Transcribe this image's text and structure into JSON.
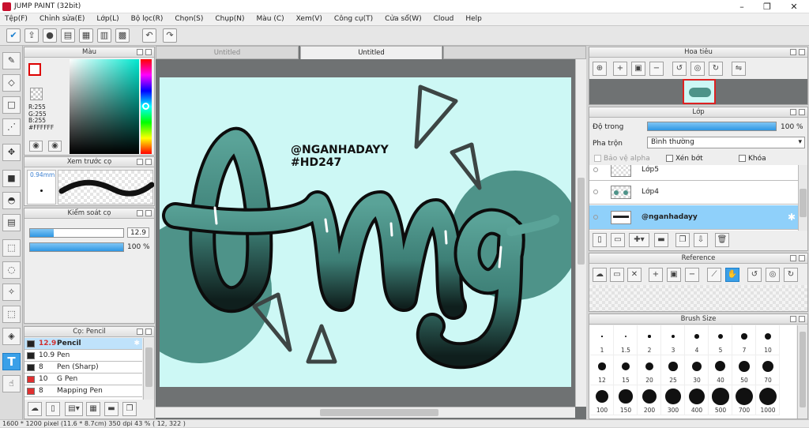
{
  "app": {
    "title": "JUMP PAINT (32bit)"
  },
  "menu": [
    "Tệp(F)",
    "Chỉnh sửa(E)",
    "Lớp(L)",
    "Bộ lọc(R)",
    "Chọn(S)",
    "Chụp(N)",
    "Màu (C)",
    "Xem(V)",
    "Công cụ(T)",
    "Cửa sổ(W)",
    "Cloud",
    "Help"
  ],
  "color_panel": {
    "title": "Màu",
    "r": "R:255",
    "g": "G:255",
    "b": "B:255",
    "hex": "#FFFFFF",
    "fg": "#ffffff",
    "bg": "#ffffff"
  },
  "brush_preview": {
    "title": "Xem trước cọ",
    "size": "0.94mm"
  },
  "brush_control": {
    "title": "Kiểm soát cọ",
    "size": "12.9",
    "opacity": "100 %",
    "size_fraction": 0.25,
    "opacity_fraction": 1.0
  },
  "brush_list": {
    "title": "Cọ: Pencil",
    "items": [
      {
        "size": "12.9",
        "name": "Pencil",
        "color": "#222222",
        "selected": true
      },
      {
        "size": "10.9",
        "name": "Pen",
        "color": "#222222",
        "selected": false
      },
      {
        "size": "8",
        "name": "Pen (Sharp)",
        "color": "#222222",
        "selected": false
      },
      {
        "size": "10",
        "name": "G Pen",
        "color": "#e03030",
        "selected": false
      },
      {
        "size": "8",
        "name": "Mapping Pen",
        "color": "#e03030",
        "selected": false
      }
    ]
  },
  "documents": {
    "tab1": "Untitled",
    "tab2": "Untitled"
  },
  "artwork": {
    "line1": "@NGANHADAYY",
    "line2": "#HD247",
    "word": "Omg"
  },
  "navigator": {
    "title": "Hoa tiêu"
  },
  "layer_panel": {
    "title": "Lớp",
    "opacity_label": "Độ trong",
    "opacity_value": "100 %",
    "opacity_fraction": 1.0,
    "blend_label": "Pha trộn",
    "blend_value": "Bình thường",
    "protect_alpha": "Bảo vệ alpha",
    "clip": "Xén bớt",
    "lock": "Khóa",
    "layers": [
      {
        "name": "Lớp5",
        "selected": false
      },
      {
        "name": "Lớp4",
        "selected": false
      },
      {
        "name": "@nganhadayy",
        "selected": true
      }
    ]
  },
  "reference": {
    "title": "Reference"
  },
  "brush_size": {
    "title": "Brush Size",
    "sizes": [
      "1",
      "1.5",
      "2",
      "3",
      "4",
      "5",
      "7",
      "10",
      "12",
      "15",
      "20",
      "25",
      "30",
      "40",
      "50",
      "70",
      "100",
      "150",
      "200",
      "300",
      "400",
      "500",
      "700",
      "1000"
    ]
  },
  "status": {
    "text": "1600 * 1200 pixel   (11.6 * 8.7cm)   350 dpi   43 %   ( 12, 322 )"
  }
}
